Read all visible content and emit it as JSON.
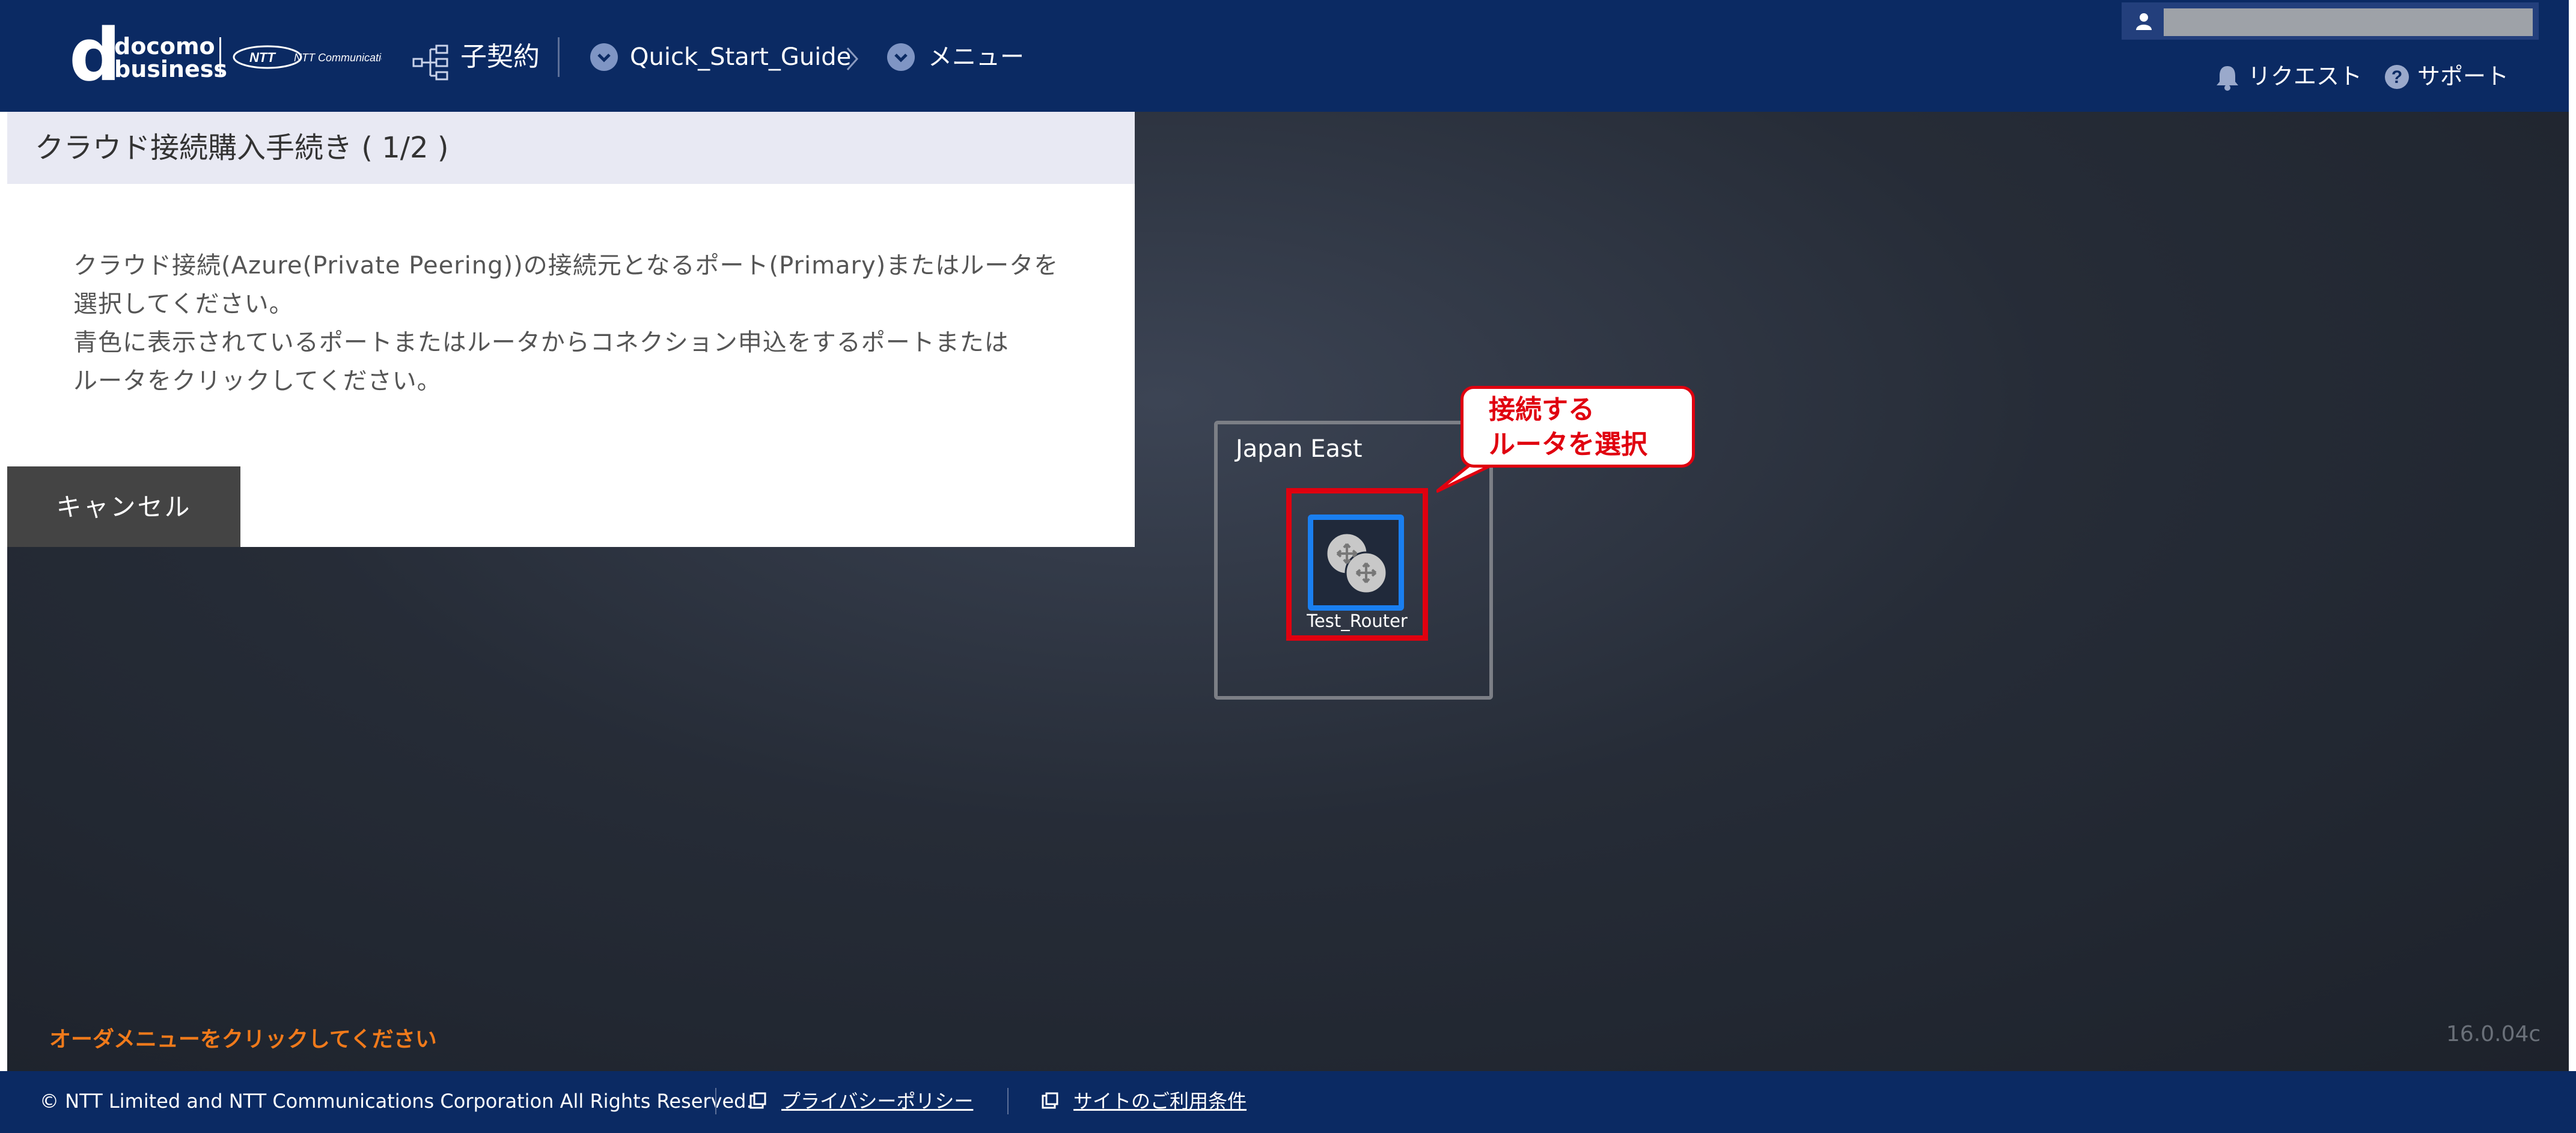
{
  "header": {
    "logo_main": "docomo",
    "logo_sub": "business",
    "ntt_logo": "NTT Communications",
    "contract": "子契約",
    "breadcrumb_1": "Quick_Start_Guide",
    "breadcrumb_sep": "›",
    "breadcrumb_2": "メニュー",
    "request": "リクエスト",
    "support": "サポート"
  },
  "panel": {
    "title": "クラウド接続購入手続き ( 1/2 )",
    "line1": "クラウド接続(Azure(Private Peering))の接続元となるポート(Primary)またはルータを",
    "line2": "選択してください。",
    "line3": "青色に表示されているポートまたはルータからコネクション申込をするポートまたは",
    "line4": "ルータをクリックしてください。",
    "cancel": "キャンセル"
  },
  "canvas": {
    "region_name": "Japan East",
    "router_name": "Test_Router",
    "callout_line1": "接続する",
    "callout_line2": "ルータを選択",
    "order_message": "オーダメニューをクリックしてください",
    "version": "16.0.04c"
  },
  "footer": {
    "copyright": "© NTT Limited and NTT Communications Corporation All Rights Reserved.",
    "privacy": "プライバシーポリシー",
    "terms": "サイトのご利用条件"
  },
  "colors": {
    "header_bg": "#0b2a63",
    "accent_blue": "#1a7ff0",
    "highlight_red": "#e0000f",
    "order_text": "#f07a1b"
  },
  "icons": [
    "hierarchy-icon",
    "chevron-circle-icon",
    "bell-icon",
    "help-icon",
    "user-icon",
    "router-icon",
    "external-link-icon"
  ]
}
